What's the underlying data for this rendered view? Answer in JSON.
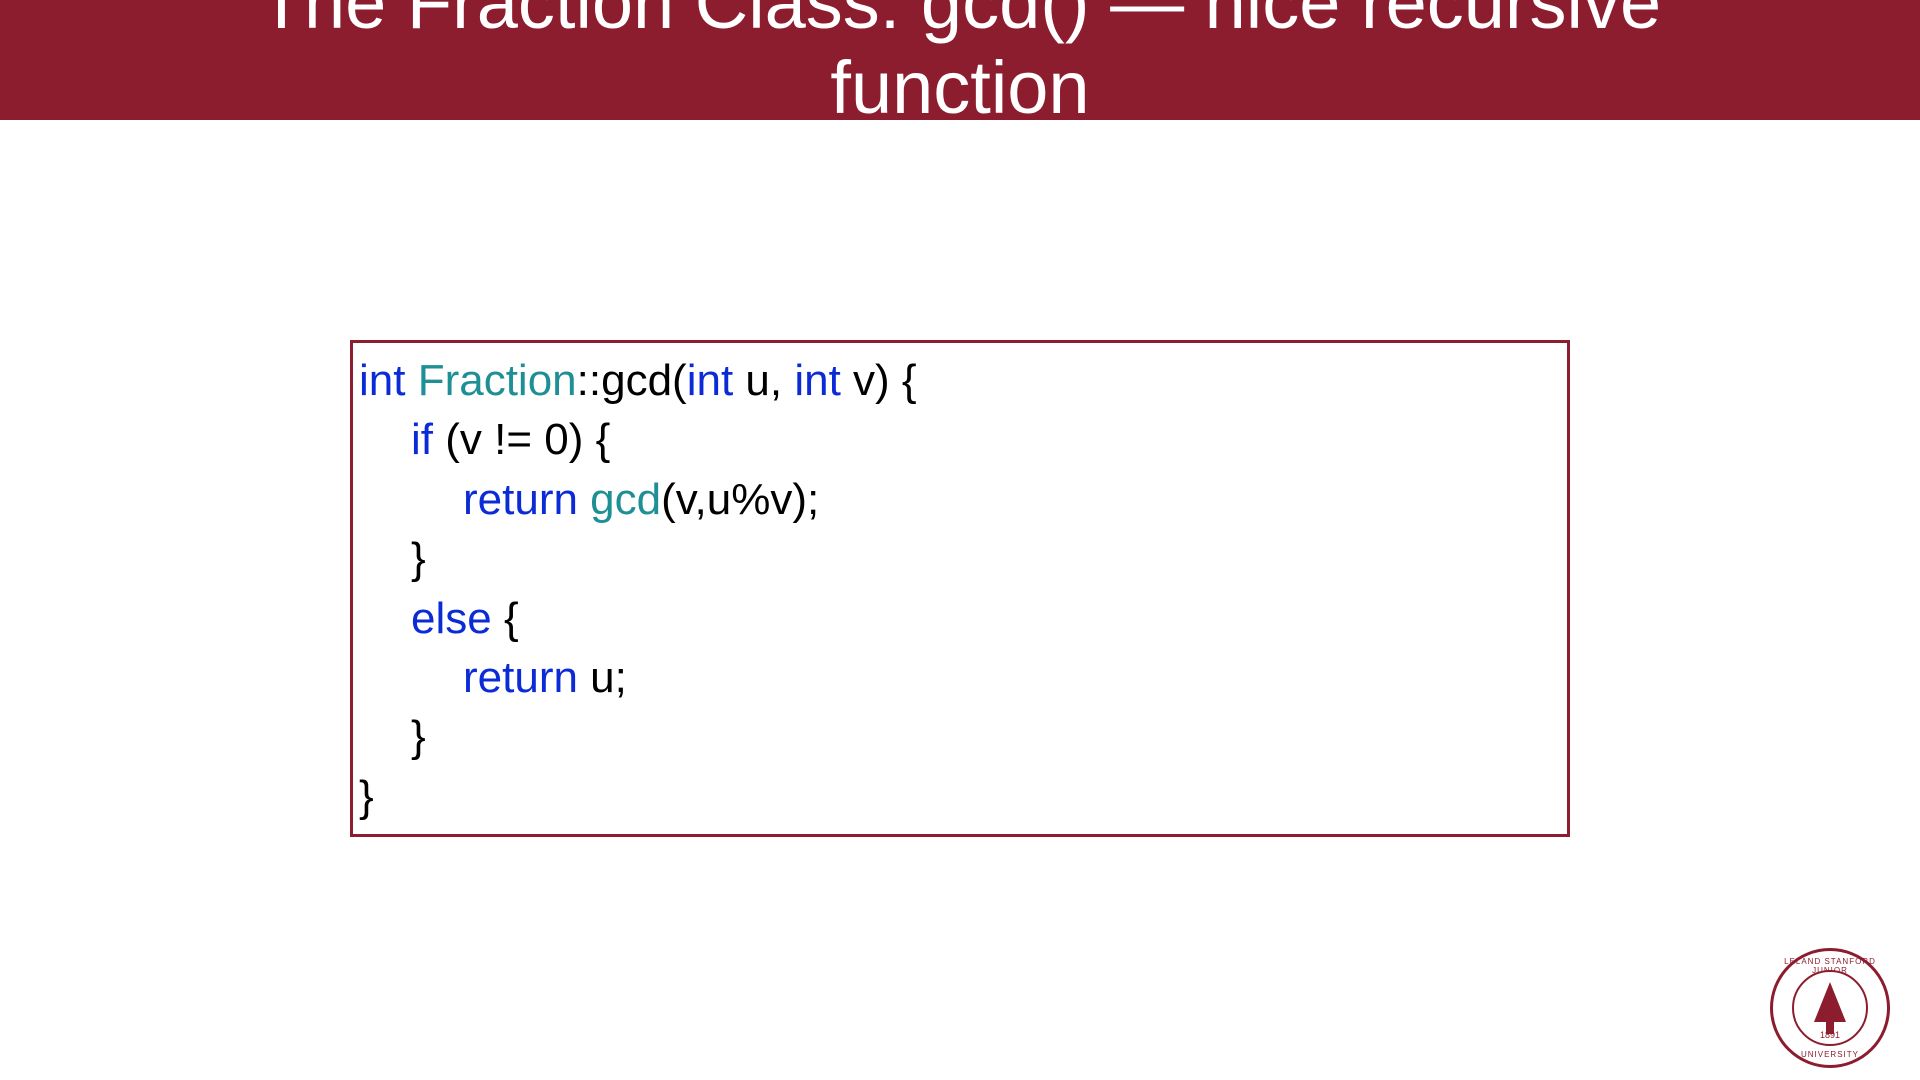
{
  "header": {
    "title_line1": "The Fraction Class: gcd() — nice recursive",
    "title_line2": "function"
  },
  "code": {
    "l1_kw1": "int",
    "l1_cls": " Fraction",
    "l1_txt1": "::gcd(",
    "l1_kw2": "int",
    "l1_txt2": " u, ",
    "l1_kw3": "int",
    "l1_txt3": " v) {",
    "l2_kw": "if",
    "l2_txt": " (v != 0) {",
    "l3_kw": "return",
    "l3_fn": " gcd",
    "l3_txt": "(v,u%v);",
    "l4_txt": "}",
    "l5_kw": "else",
    "l5_txt": " {",
    "l6_kw": "return",
    "l6_txt": " u;",
    "l7_txt": "}",
    "l8_txt": "}"
  },
  "logo": {
    "top_text": "LELAND STANFORD JUNIOR",
    "bottom_text": "UNIVERSITY",
    "year": "1891"
  }
}
